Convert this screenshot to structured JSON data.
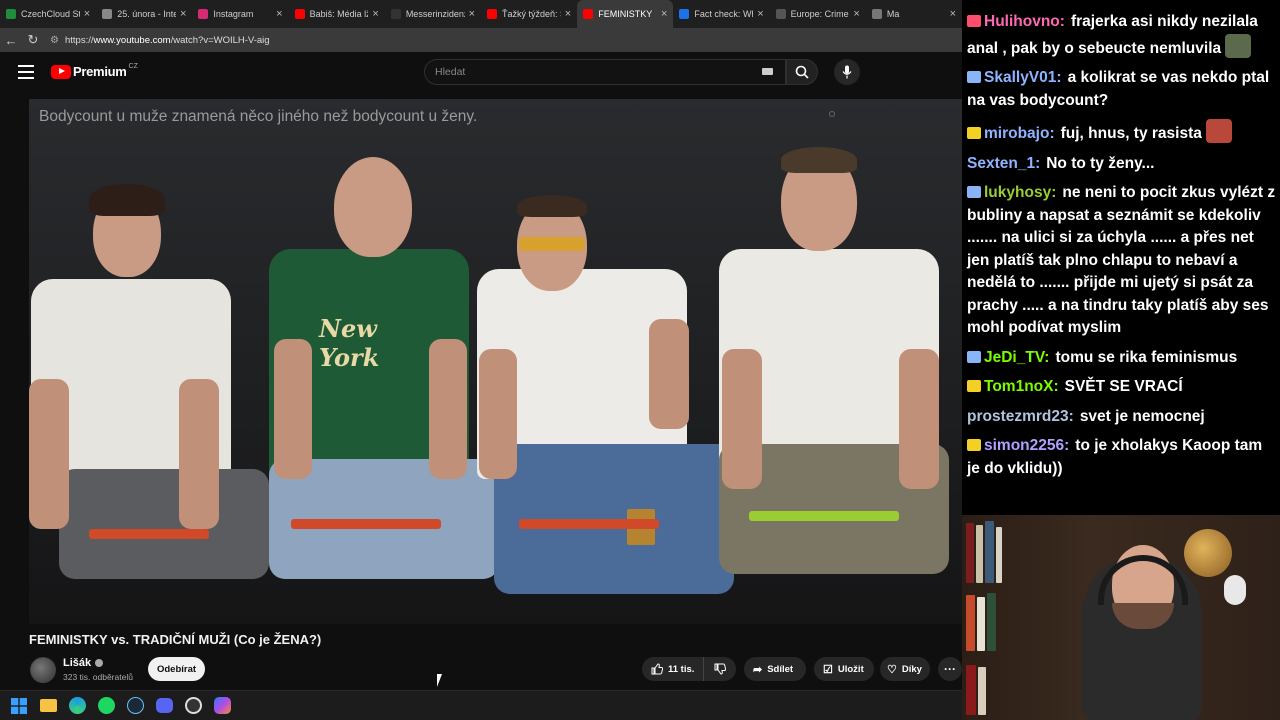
{
  "tabs": [
    {
      "label": "CzechCloud Strea",
      "color": "#1e8e3e",
      "active": false
    },
    {
      "label": "25. února - Interv",
      "color": "#888888",
      "active": false
    },
    {
      "label": "Instagram",
      "color": "#d62976",
      "active": false
    },
    {
      "label": "Babiš: Média lžou",
      "color": "#ff0000",
      "active": false
    },
    {
      "label": "Messerinzidenz",
      "color": "#333333",
      "active": false
    },
    {
      "label": "Ťažký týždeň: Slov",
      "color": "#ff0000",
      "active": false
    },
    {
      "label": "FEMINISTKY",
      "color": "#ff0000",
      "active": true
    },
    {
      "label": "Fact check: Which",
      "color": "#1a73e8",
      "active": false
    },
    {
      "label": "Europe: Crime Ind",
      "color": "#555555",
      "active": false
    },
    {
      "label": "Ma",
      "color": "#777777",
      "active": false
    }
  ],
  "address": {
    "prefix": "https://",
    "host": "www.youtube.com",
    "path": "/watch?v=WOILH-V-aig"
  },
  "youtube": {
    "logo_text": "Premium",
    "country": "CZ",
    "search_placeholder": "Hledat"
  },
  "video": {
    "overlay_text": "Bodycount u muže znamená něco jiného než bodycount u ženy.",
    "title": "FEMINISTKY vs. TRADIČNÍ MUŽI (Co je ŽENA?)",
    "channel": "Lišák",
    "subscribers": "323 tis. odběratelů",
    "subscribe_label": "Odebírat",
    "likes": "11 tis.",
    "share_label": "Sdílet",
    "save_label": "Uložit",
    "thanks_label": "Díky"
  },
  "chat": [
    {
      "user": "Hulihovno:",
      "color": "#ff69b4",
      "badge": "#ff4d6d",
      "text": "frajerka asi nikdy nezilala anal , pak by o sebeucte nemluvila",
      "emote": true
    },
    {
      "user": "SkallyV01:",
      "color": "#8fb4ff",
      "badge": "#8ab4f8",
      "text": "a kolikrat se vas nekdo ptal na vas bodycount?",
      "emote": false
    },
    {
      "user": "mirobajo:",
      "color": "#8fb4ff",
      "badge": "#f2d024",
      "text": "fuj, hnus, ty rasista",
      "emote": true
    },
    {
      "user": "Sexten_1:",
      "color": "#8fb4ff",
      "badge": "",
      "text": "No to ty ženy...",
      "emote": false
    },
    {
      "user": "lukyhosy:",
      "color": "#9acd32",
      "badge": "#8ab4f8",
      "text": "ne neni to pocit zkus vylézt z bubliny a napsat a seznámit se kdekoliv ....... na ulici si za úchyla ...... a přes net jen platíš tak plno chlapu to nebaví a nedělá to ....... přijde mi ujetý si psát za prachy ..... a na tindru taky platíš aby ses mohl podívat myslim",
      "emote": false
    },
    {
      "user": "JeDi_TV:",
      "color": "#7cfc00",
      "badge": "#8ab4f8",
      "text": "tomu se rika feminismus",
      "emote": false
    },
    {
      "user": "Tom1noX:",
      "color": "#7cfc00",
      "badge": "#f2d024",
      "text": "SVĚT SE VRACÍ",
      "emote": false
    },
    {
      "user": "prostezmrd23:",
      "color": "#b0c4de",
      "badge": "",
      "text": "svet je nemocnej",
      "emote": false
    },
    {
      "user": "simon2256:",
      "color": "#b0a0ff",
      "badge": "#f2d024",
      "text": "to je xholakys Kaoop tam je do vklidu))",
      "emote": false
    }
  ]
}
